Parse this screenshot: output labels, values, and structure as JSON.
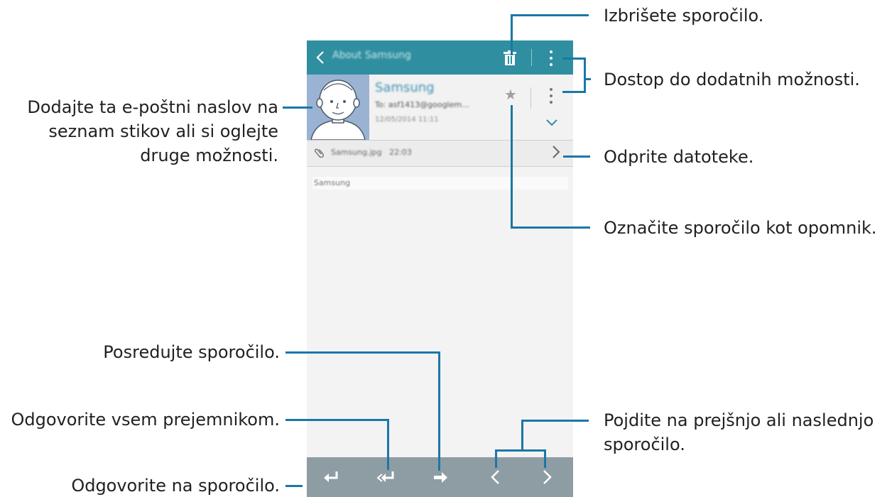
{
  "screen": {
    "app_title": "About Samsung",
    "sender_name": "Samsung",
    "to_line": "To: asf1413@googlem...",
    "date_line": "12/05/2014 11:11",
    "attachment_name": "Samsung.jpg",
    "attachment_time": "22:03",
    "body_preview": "Samsung"
  },
  "icons": {
    "back": "chevron-left-icon",
    "delete": "trash-icon",
    "more": "more-vertical-icon",
    "star": "star-icon",
    "expand": "chevron-down-icon",
    "attachment": "paperclip-icon",
    "open": "chevron-right-icon",
    "reply": "reply-icon",
    "reply_all": "reply-all-icon",
    "forward": "forward-icon",
    "prev": "chevron-left-icon",
    "next": "chevron-right-icon"
  },
  "colors": {
    "app_bar": "#2f8fa0",
    "bottom_bar": "#8e9da3",
    "callout_line": "#1b77a6",
    "avatar_bg": "#9bb3d3",
    "sender_text": "#3f8fb5"
  },
  "annotations": {
    "delete": "Izbrišete sporočilo.",
    "more_options": "Dostop do dodatnih možnosti.",
    "contact_line1": "Dodajte ta e-poštni naslov na",
    "contact_line2": "seznam stikov ali si oglejte",
    "contact_line3": "druge možnosti.",
    "open_files": "Odprite datoteke.",
    "flag": "Označite sporočilo kot opomnik.",
    "forward": "Posredujte sporočilo.",
    "reply_all": "Odgovorite vsem prejemnikom.",
    "reply": "Odgovorite na sporočilo.",
    "nav_line1": "Pojdite na prejšnjo ali naslednjo",
    "nav_line2": "sporočilo."
  }
}
